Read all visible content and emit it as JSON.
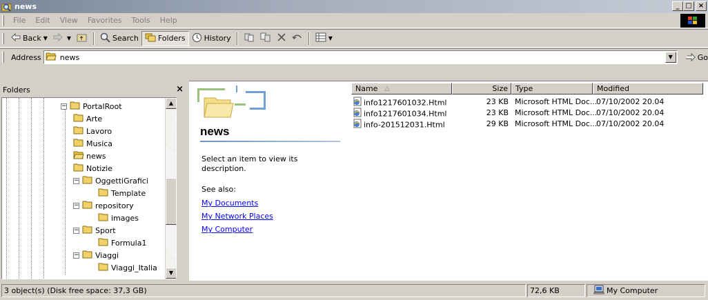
{
  "window": {
    "title": "news"
  },
  "title_buttons": {
    "minimize": "_",
    "maximize": "□",
    "close": "×"
  },
  "menu": [
    "File",
    "Edit",
    "View",
    "Favorites",
    "Tools",
    "Help"
  ],
  "toolbar": {
    "back": "Back",
    "search": "Search",
    "folders": "Folders",
    "history": "History"
  },
  "address": {
    "label": "Address",
    "value": "news",
    "go": "Go"
  },
  "folders_pane": {
    "title": "Folders",
    "close": "×"
  },
  "tree": [
    {
      "label": "PortalRoot",
      "expander": "−"
    },
    {
      "label": "Arte"
    },
    {
      "label": "Lavoro"
    },
    {
      "label": "Musica"
    },
    {
      "label": "news",
      "open": true
    },
    {
      "label": "Notizie"
    },
    {
      "label": "OggettiGrafici",
      "expander": "−"
    },
    {
      "label": "Template"
    },
    {
      "label": "repository",
      "expander": "−"
    },
    {
      "label": "images"
    },
    {
      "label": "Sport",
      "expander": "−"
    },
    {
      "label": "Formula1"
    },
    {
      "label": "Viaggi",
      "expander": "−"
    },
    {
      "label": "Viaggi_Italia"
    }
  ],
  "webview": {
    "title": "news",
    "description": "Select an item to view its description.",
    "see_also": "See also:",
    "links": [
      "My Documents",
      "My Network Places",
      "My Computer"
    ]
  },
  "columns": {
    "name": "Name",
    "sort_indicator": "△",
    "size": "Size",
    "type": "Type",
    "modified": "Modified"
  },
  "files": [
    {
      "name": "info1217601032.Html",
      "size": "23 KB",
      "type": "Microsoft HTML Doc...",
      "modified": "07/10/2002 20.04"
    },
    {
      "name": "info1217601034.Html",
      "size": "23 KB",
      "type": "Microsoft HTML Doc...",
      "modified": "07/10/2002 20.04"
    },
    {
      "name": "info-201512031.Html",
      "size": "29 KB",
      "type": "Microsoft HTML Doc...",
      "modified": "07/10/2002 20.04"
    }
  ],
  "status": {
    "objects": "3 object(s) (Disk free space: 37,3 GB)",
    "size": "72,6 KB",
    "zone": "My Computer"
  }
}
